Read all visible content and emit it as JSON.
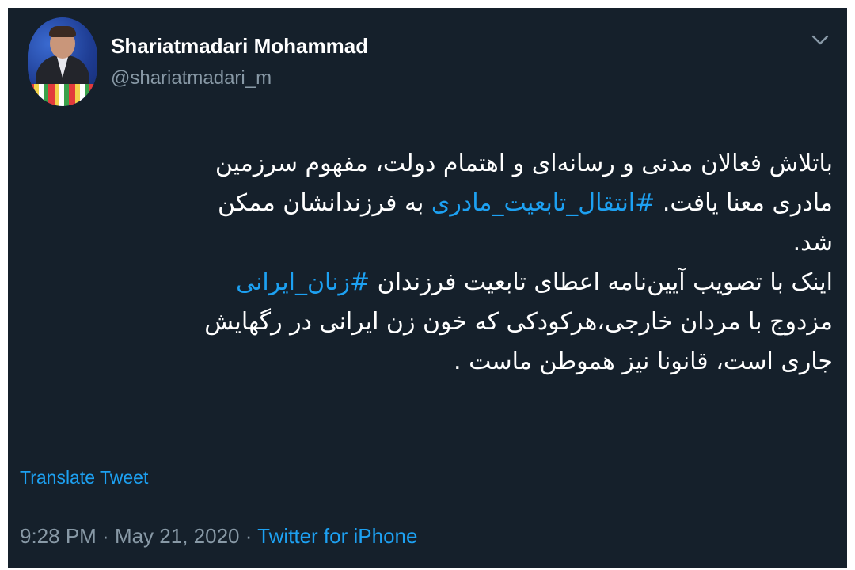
{
  "author": {
    "display_name": "Shariatmadari Mohammad",
    "handle": "@shariatmadari_m"
  },
  "menu": {
    "icon": "chevron-down-icon"
  },
  "tweet": {
    "lines": [
      [
        {
          "text": "باتلاش فعالان مدنی و رسانه‌ای و اهتمام دولت، مفهوم سرزمین",
          "hashtag": false
        }
      ],
      [
        {
          "text": "مادری معنا یافت. ",
          "hashtag": false
        },
        {
          "text": "#انتقال_تابعیت_مادری",
          "hashtag": true
        },
        {
          "text": " به فرزندانشان ممکن",
          "hashtag": false
        }
      ],
      [
        {
          "text": "شد.",
          "hashtag": false
        }
      ],
      [
        {
          "text": "اینک با تصویب آیین‌نامه اعطای تابعیت فرزندان ",
          "hashtag": false
        },
        {
          "text": "#زنان_ایرانی",
          "hashtag": true
        }
      ],
      [
        {
          "text": "مزدوج با مردان خارجی،هرکودکی که خون زن ایرانی در رگهایش",
          "hashtag": false
        }
      ],
      [
        {
          "text": "جاری است، قانونا نیز هموطن ماست .",
          "hashtag": false
        }
      ]
    ]
  },
  "translate_label": "Translate Tweet",
  "meta": {
    "time": "9:28 PM",
    "separator": " · ",
    "date": "May 21, 2020",
    "source": "Twitter for iPhone"
  },
  "colors": {
    "background": "#15202b",
    "text": "#ffffff",
    "secondary": "#8899a6",
    "accent": "#1da1f2"
  }
}
